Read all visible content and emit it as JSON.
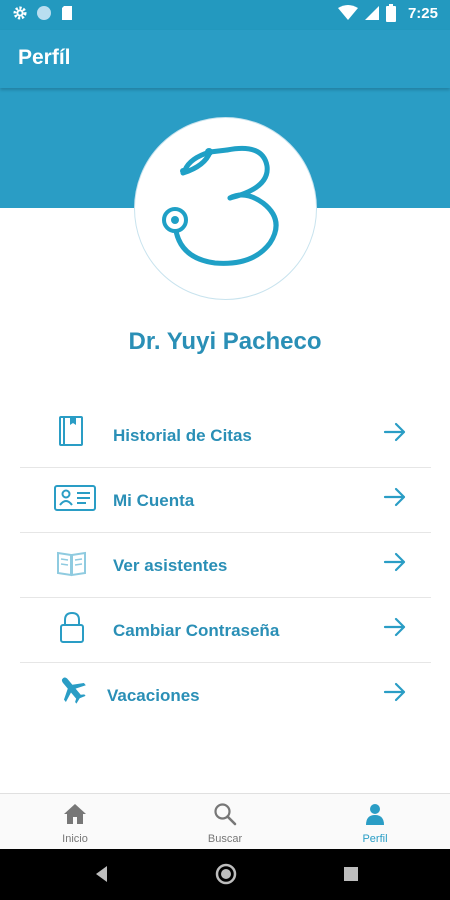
{
  "status_bar": {
    "time": "7:25",
    "left_icons": [
      "gear-icon",
      "circle-icon",
      "sd-card-icon"
    ],
    "right_icons": [
      "wifi-icon",
      "signal-icon",
      "battery-icon"
    ]
  },
  "app_bar": {
    "title": "Perfíl"
  },
  "profile": {
    "name": "Dr. Yuyi Pacheco"
  },
  "menu": {
    "items": [
      {
        "label": "Historial de Citas",
        "icon": "book-icon"
      },
      {
        "label": "Mi Cuenta",
        "icon": "id-card-icon"
      },
      {
        "label": "Ver asistentes",
        "icon": "open-book-icon"
      },
      {
        "label": "Cambiar Contraseña",
        "icon": "lock-icon"
      },
      {
        "label": "Vacaciones",
        "icon": "airplane-icon"
      }
    ]
  },
  "bottom_nav": {
    "tabs": [
      {
        "label": "Inicio",
        "icon": "home-icon",
        "active": false
      },
      {
        "label": "Buscar",
        "icon": "search-icon",
        "active": false
      },
      {
        "label": "Perfil",
        "icon": "person-icon",
        "active": true
      }
    ]
  },
  "colors": {
    "primary": "#2a9dc5",
    "status_bar": "#2399bf",
    "text_accent": "#2a8fb6",
    "nav_inactive": "#777777"
  }
}
